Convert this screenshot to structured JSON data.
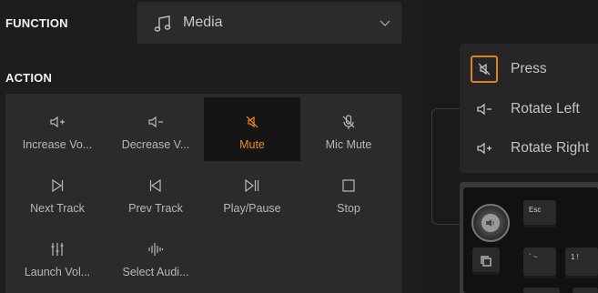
{
  "function": {
    "label": "FUNCTION",
    "selected": "Media",
    "selected_icon": "music-note-icon",
    "dropdown_icon": "chevron-down-icon"
  },
  "action": {
    "label": "ACTION",
    "items": [
      {
        "label": "Increase Vo...",
        "icon": "volume-up-icon"
      },
      {
        "label": "Decrease V...",
        "icon": "volume-down-icon"
      },
      {
        "label": "Mute",
        "icon": "mute-icon",
        "active": true
      },
      {
        "label": "Mic Mute",
        "icon": "mic-mute-icon"
      },
      {
        "label": "Next Track",
        "icon": "next-track-icon"
      },
      {
        "label": "Prev Track",
        "icon": "prev-track-icon"
      },
      {
        "label": "Play/Pause",
        "icon": "play-pause-icon"
      },
      {
        "label": "Stop",
        "icon": "stop-icon"
      },
      {
        "label": "Launch Vol...",
        "icon": "mixer-sliders-icon"
      },
      {
        "label": "Select Audi...",
        "icon": "audio-wave-icon"
      }
    ]
  },
  "knob_actions": [
    {
      "label": "Press",
      "icon": "mute-icon",
      "selected": true
    },
    {
      "label": "Rotate Left",
      "icon": "volume-down-icon"
    },
    {
      "label": "Rotate Right",
      "icon": "volume-up-icon"
    }
  ],
  "keyboard": {
    "esc_key": "Esc",
    "backtick_key": "` ~",
    "one_key": "1 !"
  },
  "colors": {
    "accent": "#f08a24",
    "panel": "#2b2b2d",
    "background": "#1d1d1e"
  }
}
